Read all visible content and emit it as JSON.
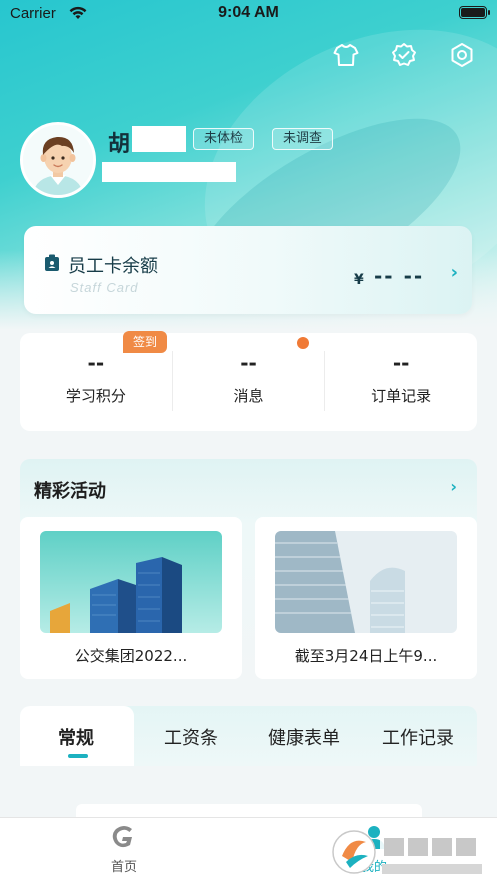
{
  "status_bar": {
    "carrier": "Carrier",
    "time": "9:04 AM"
  },
  "header": {
    "icons": [
      "shirt-icon",
      "badge-check-icon",
      "settings-icon"
    ],
    "user": {
      "name": "胡",
      "tags": [
        "未体检",
        "未调查"
      ]
    }
  },
  "staff_card": {
    "title": "员工卡余额",
    "subtitle": "Staff Card",
    "currency": "¥",
    "amount": "-- --"
  },
  "stats": [
    {
      "value": "--",
      "label": "学习积分",
      "badge": "签到"
    },
    {
      "value": "--",
      "label": "消息",
      "has_dot": true
    },
    {
      "value": "--",
      "label": "订单记录"
    }
  ],
  "activities": {
    "title": "精彩活动",
    "items": [
      {
        "caption": "公交集团2022..."
      },
      {
        "caption": "截至3月24日上午9..."
      }
    ]
  },
  "tabs": [
    {
      "label": "常规",
      "active": true
    },
    {
      "label": "工资条"
    },
    {
      "label": "健康表单"
    },
    {
      "label": "工作记录"
    }
  ],
  "bottom_nav": [
    {
      "label": "首页",
      "icon": "home-g-icon"
    },
    {
      "label": "我的",
      "icon": "profile-icon"
    }
  ],
  "colors": {
    "accent": "#1cb1c0",
    "badge": "#f08a45",
    "dot": "#f07a36"
  }
}
